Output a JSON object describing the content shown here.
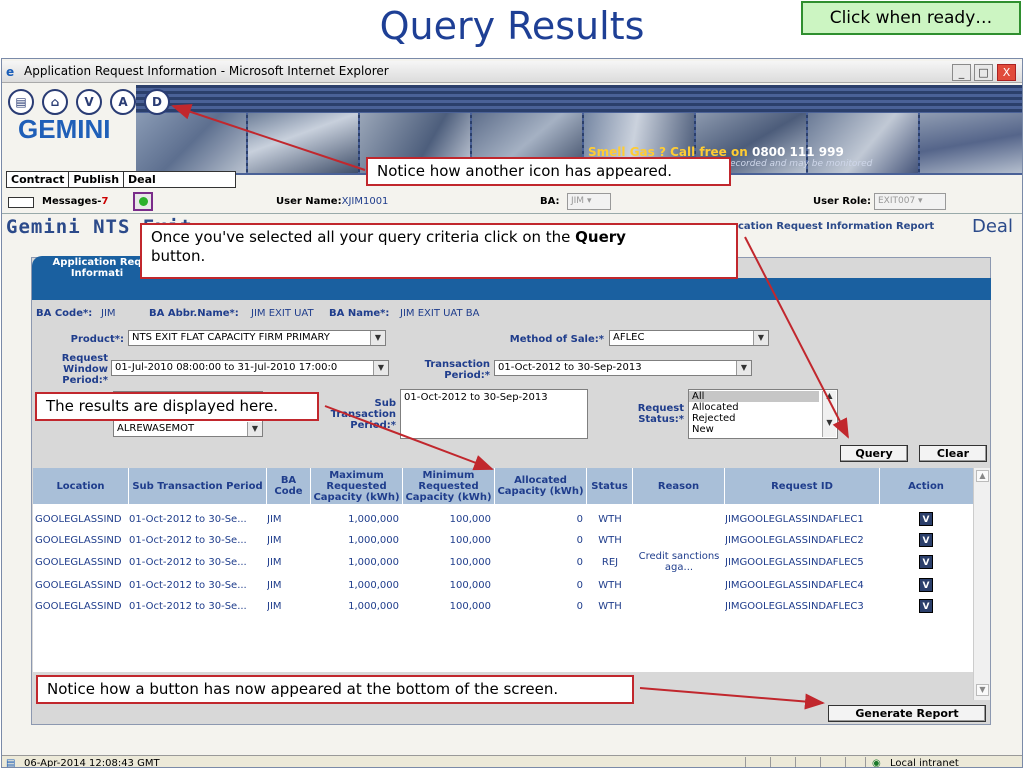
{
  "slide": {
    "title": "Query Results",
    "ready_button": "Click when ready…"
  },
  "window": {
    "title": "Application Request Information - Microsoft Internet Explorer",
    "minimize": "_",
    "maximize": "□",
    "close": "X"
  },
  "header": {
    "icons": [
      "print-icon",
      "home-icon",
      "V",
      "A",
      "D"
    ],
    "logo": "GEMINI",
    "banner_text": "Smell Gas ? Call free on",
    "banner_number": "0800 111 999",
    "banner_sub": "ecorded and may be monitored"
  },
  "menu": [
    "Contract",
    "Publish",
    "Deal"
  ],
  "userbar": {
    "messages_label": "Messages-",
    "messages_count": "7",
    "username_label": "User Name:",
    "username_value": "XJIM1001",
    "ba_label": "BA:",
    "ba_value": "JIM",
    "role_label": "User Role:",
    "role_value": "EXIT007"
  },
  "page": {
    "heading": "Gemini NTS Exit",
    "report_link": "cation Request Information Report",
    "deal_link": "Deal",
    "tab_label_1": "Application Req",
    "tab_label_2": "Informati"
  },
  "form": {
    "ba_code_label": "BA Code*:",
    "ba_code_value": "JIM",
    "ba_abbr_label": "BA Abbr.Name*:",
    "ba_abbr_value": "JIM EXIT UAT",
    "ba_name_label": "BA Name*:",
    "ba_name_value": "JIM EXIT UAT BA",
    "product_label": "Product*:",
    "product_value": "NTS EXIT FLAT CAPACITY FIRM PRIMARY",
    "method_label": "Method of Sale:*",
    "method_value": "AFLEC",
    "window_label_1": "Request",
    "window_label_2": "Window",
    "window_label_3": "Period:*",
    "window_value": "01-Jul-2010 08:00:00 to 31-Jul-2010 17:00:0",
    "transaction_label_1": "Transaction",
    "transaction_label_2": "Period:*",
    "transaction_value": "01-Oct-2012 to 30-Sep-2013",
    "location_value": "ALREWASEMOT",
    "sub_label_1": "Sub",
    "sub_label_2": "Transaction",
    "sub_label_3": "Period:*",
    "sub_value": "01-Oct-2012 to 30-Sep-2013",
    "status_label_1": "Request",
    "status_label_2": "Status:*",
    "status_options": [
      "All",
      "Allocated",
      "Rejected",
      "New"
    ],
    "query_button": "Query",
    "clear_button": "Clear",
    "generate_button": "Generate Report"
  },
  "table": {
    "headers": [
      "Location",
      "Sub Transaction Period",
      "BA Code",
      "Maximum Requested Capacity (kWh)",
      "Minimum Requested Capacity (kWh)",
      "Allocated Capacity (kWh)",
      "Status",
      "Reason",
      "Request ID",
      "Action"
    ],
    "rows": [
      [
        "GOOLEGLASSIND",
        "01-Oct-2012 to 30-Se...",
        "JIM",
        "1,000,000",
        "100,000",
        "0",
        "WTH",
        "",
        "JIMGOOLEGLASSINDAFLEC1",
        "V"
      ],
      [
        "GOOLEGLASSIND",
        "01-Oct-2012 to 30-Se...",
        "JIM",
        "1,000,000",
        "100,000",
        "0",
        "WTH",
        "",
        "JIMGOOLEGLASSINDAFLEC2",
        "V"
      ],
      [
        "GOOLEGLASSIND",
        "01-Oct-2012 to 30-Se...",
        "JIM",
        "1,000,000",
        "100,000",
        "0",
        "REJ",
        "Credit sanctions aga...",
        "JIMGOOLEGLASSINDAFLEC5",
        "V"
      ],
      [
        "GOOLEGLASSIND",
        "01-Oct-2012 to 30-Se...",
        "JIM",
        "1,000,000",
        "100,000",
        "0",
        "WTH",
        "",
        "JIMGOOLEGLASSINDAFLEC4",
        "V"
      ],
      [
        "GOOLEGLASSIND",
        "01-Oct-2012 to 30-Se...",
        "JIM",
        "1,000,000",
        "100,000",
        "0",
        "WTH",
        "",
        "JIMGOOLEGLASSINDAFLEC3",
        "V"
      ]
    ]
  },
  "status_bar": {
    "timestamp": "06-Apr-2014  12:08:43 GMT",
    "zone": "Local intranet"
  },
  "callouts": {
    "icon_note": "Notice how another icon has appeared.",
    "query_note_1": "Once you've selected all your query criteria click on the ",
    "query_note_bold": "Query",
    "query_note_2": "button.",
    "results_note": "The results are displayed here.",
    "button_note": "Notice how a button has now appeared at the bottom of the screen."
  },
  "colors": {
    "title": "#1e3f95",
    "callout_border": "#c1272d",
    "ready_bg": "#ccf5c2",
    "tab_blue": "#1a60a0"
  }
}
